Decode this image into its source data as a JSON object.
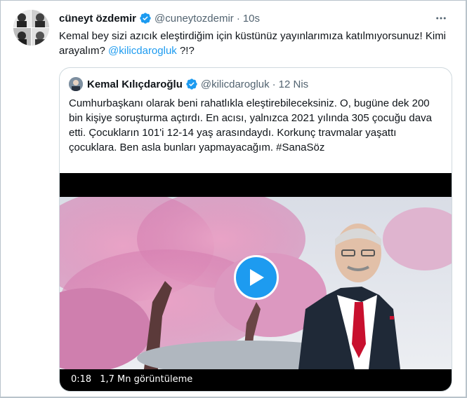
{
  "tweet": {
    "author_name": "cüneyt özdemir",
    "handle": "@cuneytozdemir",
    "separator": "·",
    "time": "10s",
    "text_before": "Kemal bey sizi azıcık eleştirdiğim için küstünüz yayınlarımıza katılmıyorsunuz! Kimi arayalım? ",
    "mention": "@kilicdarogluk",
    "text_after": " ?!?",
    "more_icon": "more-horizontal-icon",
    "verified_icon": "verified-badge-icon"
  },
  "quoted": {
    "author_name": "Kemal Kılıçdaroğlu",
    "handle": "@kilicdarogluk",
    "separator": "·",
    "date": "12 Nis",
    "text": "Cumhurbaşkanı olarak beni rahatlıkla eleştirebileceksiniz. O, bugüne dek 200 bin kişiye soruşturma açtırdı. En acısı, yalnızca 2021 yılında 305 çocuğu dava etti. Çocukların 101'i 12-14 yaş arasındaydı. Korkunç travmalar yaşattı çocuklara. Ben asla bunları yapmayacağım. #SanaSöz"
  },
  "video": {
    "duration": "0:18",
    "views": "1,7 Mn görüntüleme",
    "play_icon": "play-icon"
  },
  "colors": {
    "accent": "#1d9bf0",
    "text": "#0f1419",
    "secondary": "#536471",
    "border": "#cfd9de"
  }
}
